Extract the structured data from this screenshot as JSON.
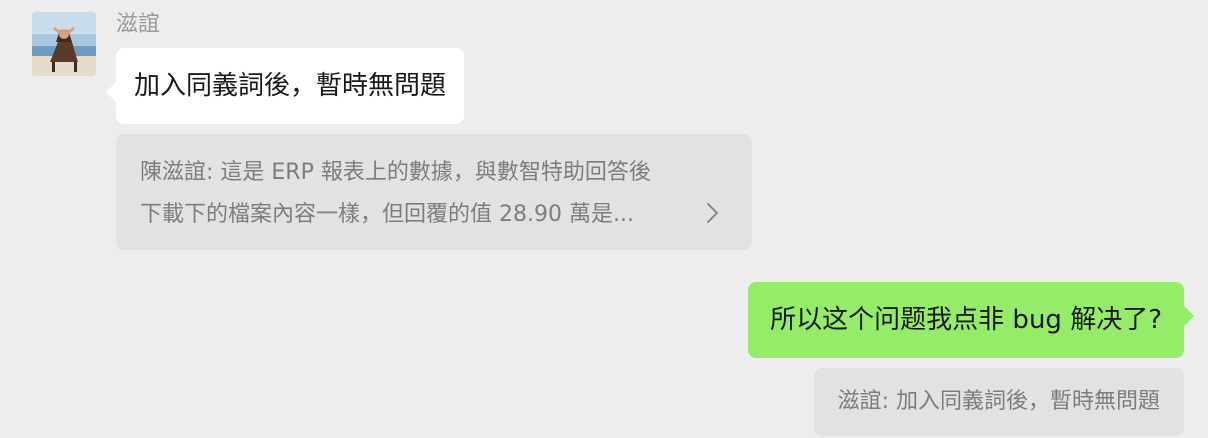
{
  "incoming": {
    "sender_name": "滋誼",
    "avatar_icon": "beach-chair-photo-avatar",
    "message": "加入同義詞後，暫時無問題",
    "quote": {
      "line1": "陳滋誼: 這是 ERP 報表上的數據，與數智特助回答後",
      "line2": "下載下的檔案內容一樣，但回覆的值 28.90 萬是...",
      "arrow_icon": "chevron-right-icon"
    }
  },
  "outgoing": {
    "message": "所以这个问题我点非 bug 解决了?",
    "quote": "滋誼: 加入同義詞後，暫時無問題"
  },
  "colors": {
    "background": "#ededed",
    "incoming_bubble": "#ffffff",
    "outgoing_bubble": "#95ec69",
    "quote_bg": "#e2e2e2",
    "quote_text": "#7d7d7d",
    "name_text": "#9b9b9b"
  }
}
